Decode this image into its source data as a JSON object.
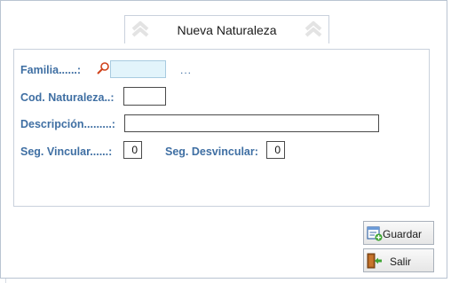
{
  "tab": {
    "title": "Nueva Naturaleza"
  },
  "form": {
    "familia_label": "Familia......:",
    "familia_value": "",
    "familia_more": "...",
    "cod_label": "Cod. Naturaleza..:",
    "cod_value": "",
    "descripcion_label": "Descripción.........:",
    "descripcion_value": "",
    "seg_vincular_label": "Seg. Vincular......:",
    "seg_vincular_value": "0",
    "seg_desvincular_label": "Seg. Desvincular:",
    "seg_desvincular_value": "0"
  },
  "buttons": {
    "guardar": "Guardar",
    "salir": "Salir"
  },
  "icons": {
    "tab_left": "double-chevron-up-icon",
    "tab_right": "double-chevron-up-icon",
    "lookup": "search-icon",
    "guardar": "save-form-icon",
    "salir": "exit-door-icon"
  },
  "colors": {
    "label": "#3f6fa3",
    "highlight_field": "#e2f4fb",
    "lookup_icon": "#d0421b"
  }
}
